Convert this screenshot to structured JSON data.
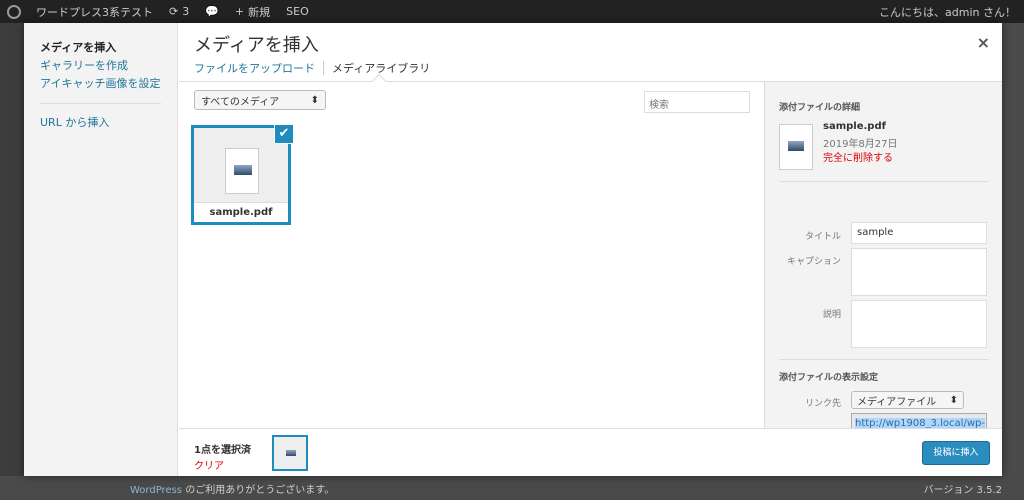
{
  "adminbar": {
    "site_name": "ワードプレス3系テスト",
    "updates": "3",
    "new_label": "新規",
    "seo_label": "SEO",
    "greeting": "こんにちは、admin さん！"
  },
  "modal": {
    "title": "メディアを挿入",
    "close": "×",
    "menu": [
      {
        "label": "メディアを挿入"
      },
      {
        "label": "ギャラリーを作成"
      },
      {
        "label": "アイキャッチ画像を設定"
      },
      {
        "label": "URL から挿入"
      }
    ],
    "tabs": [
      {
        "label": "ファイルをアップロード"
      },
      {
        "label": "メディアライブラリ"
      }
    ],
    "filter": {
      "value": "すべてのメディア"
    },
    "search": {
      "placeholder": "検索"
    },
    "attachments": [
      {
        "filename": "sample.pdf",
        "selected": true
      }
    ]
  },
  "details": {
    "heading": "添付ファイルの詳細",
    "filename": "sample.pdf",
    "date": "2019年8月27日",
    "delete_label": "完全に削除する",
    "fields": {
      "title_label": "タイトル",
      "title_value": "sample",
      "caption_label": "キャプション",
      "description_label": "説明"
    },
    "display": {
      "heading": "添付ファイルの表示設定",
      "link_label": "リンク先",
      "link_value": "メディアファイル",
      "url": "http://wp1908_3.local/wp-"
    }
  },
  "toolbar": {
    "selection_count": "1点を選択済",
    "clear_label": "クリア",
    "insert_label": "投稿に挿入"
  },
  "footer": {
    "wordpress_link": "WordPress",
    "thanks": " のご利用ありがとうございます。",
    "version": "バージョン 3.5.2"
  },
  "colors": {
    "accent": "#1e8cbe",
    "link": "#21759b",
    "danger": "#dd0000"
  }
}
